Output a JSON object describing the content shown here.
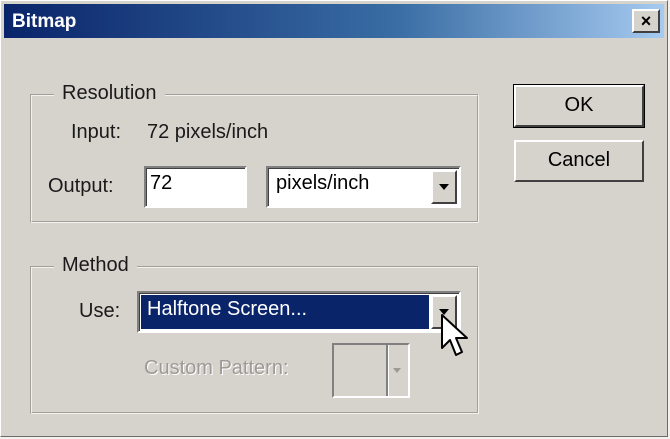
{
  "window": {
    "title": "Bitmap",
    "close_label": "×"
  },
  "resolution": {
    "legend": "Resolution",
    "input_label": "Input:",
    "input_value": "72 pixels/inch",
    "output_label": "Output:",
    "output_value": "72",
    "output_unit": "pixels/inch"
  },
  "method": {
    "legend": "Method",
    "use_label": "Use:",
    "use_value": "Halftone Screen...",
    "custom_pattern_label": "Custom Pattern:"
  },
  "buttons": {
    "ok": "OK",
    "cancel": "Cancel"
  },
  "icons": {
    "close": "close-icon",
    "dropdown": "chevron-down-icon",
    "cursor": "mouse-pointer-icon"
  },
  "colors": {
    "titlebar": "#0a246a",
    "selection": "#0a246a",
    "dialog_bg": "#d6d3cc"
  }
}
